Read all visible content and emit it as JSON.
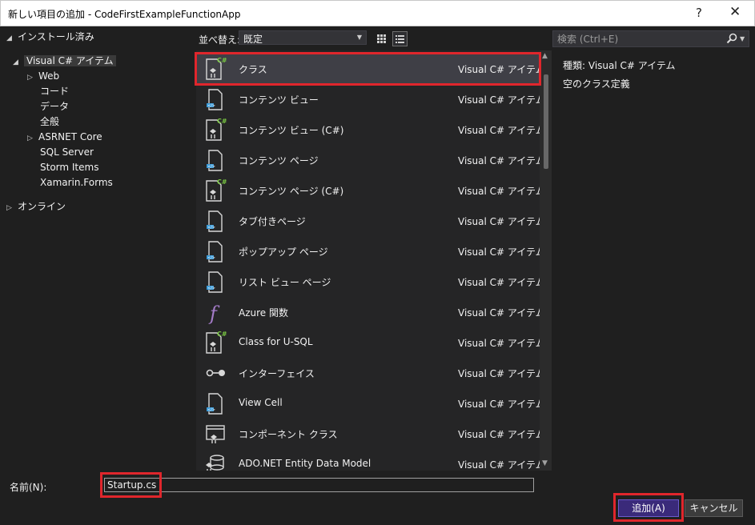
{
  "window": {
    "title": "新しい項目の追加 - CodeFirstExampleFunctionApp",
    "help": "?",
    "close": "✕"
  },
  "tree": {
    "installed": "インストール済み",
    "items": [
      {
        "label": "Visual C# アイテム"
      },
      {
        "label": "Web"
      },
      {
        "label": "コード"
      },
      {
        "label": "データ"
      },
      {
        "label": "全般"
      },
      {
        "label": "ASRNET Core"
      },
      {
        "label": "SQL Server"
      },
      {
        "label": "Storm Items"
      },
      {
        "label": "Xamarin.Forms"
      }
    ],
    "online": "オンライン"
  },
  "toolbar": {
    "sort_label": "並べ替え:",
    "sort_value": "既定"
  },
  "items": [
    {
      "name": "クラス",
      "category": "Visual C# アイテム",
      "icon": "csharp-class"
    },
    {
      "name": "コンテンツ ビュー",
      "category": "Visual C# アイテム",
      "icon": "xaml-page"
    },
    {
      "name": "コンテンツ ビュー (C#)",
      "category": "Visual C# アイテム",
      "icon": "csharp-class"
    },
    {
      "name": "コンテンツ ページ",
      "category": "Visual C# アイテム",
      "icon": "xaml-page"
    },
    {
      "name": "コンテンツ ページ (C#)",
      "category": "Visual C# アイテム",
      "icon": "csharp-class"
    },
    {
      "name": "タブ付きページ",
      "category": "Visual C# アイテム",
      "icon": "xaml-page"
    },
    {
      "name": "ポップアップ ページ",
      "category": "Visual C# アイテム",
      "icon": "xaml-page"
    },
    {
      "name": "リスト ビュー ページ",
      "category": "Visual C# アイテム",
      "icon": "xaml-page"
    },
    {
      "name": "Azure 関数",
      "category": "Visual C# アイテム",
      "icon": "function"
    },
    {
      "name": "Class for U-SQL",
      "category": "Visual C# アイテム",
      "icon": "csharp-class"
    },
    {
      "name": "インターフェイス",
      "category": "Visual C# アイテム",
      "icon": "interface"
    },
    {
      "name": "View Cell",
      "category": "Visual C# アイテム",
      "icon": "xaml-page"
    },
    {
      "name": "コンポーネント クラス",
      "category": "Visual C# アイテム",
      "icon": "component"
    },
    {
      "name": "ADO.NET Entity Data Model",
      "category": "Visual C# アイテム",
      "icon": "entity-model"
    }
  ],
  "search": {
    "placeholder": "検索 (Ctrl+E)",
    "value": ""
  },
  "details": {
    "type_label": "種類:",
    "type_value": "Visual C# アイテム",
    "description": "空のクラス定義"
  },
  "bottom": {
    "name_label": "名前(N):",
    "name_value": "Startup.cs",
    "add_button": "追加(A)",
    "cancel_button": "キャンセル"
  }
}
